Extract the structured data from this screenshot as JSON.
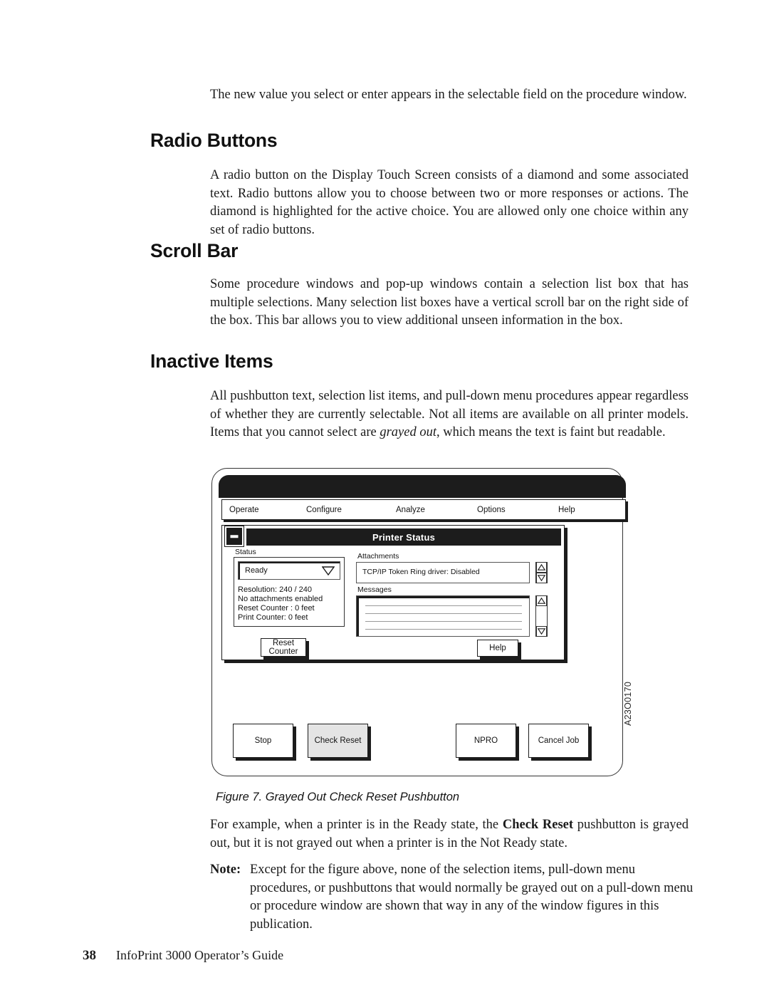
{
  "document": {
    "intro_paragraph": "The new value you select or enter appears in the selectable field on the procedure window.",
    "sections": [
      {
        "heading": "Radio Buttons",
        "body": "A radio button on the Display Touch Screen consists of a diamond and some associated text. Radio buttons allow you to choose between two or more responses or actions. The diamond is highlighted for the active choice. You are allowed only one choice within any set of radio buttons."
      },
      {
        "heading": "Scroll Bar",
        "body": "Some procedure windows and pop-up windows contain a selection list box that has multiple selections. Many selection list boxes have a vertical scroll bar on the right side of the box. This bar allows you to view additional unseen information in the box."
      },
      {
        "heading": "Inactive Items",
        "body_part1": "All pushbutton text, selection list items, and pull-down menu procedures appear regardless of whether they are currently selectable. Not all items are available on all printer models. Items that you cannot select are ",
        "body_italic": "grayed out",
        "body_part2": ", which means the text is faint but readable."
      }
    ],
    "figure_caption": "Figure 7. Grayed Out Check Reset Pushbutton",
    "after_figure_part1": "For example, when a printer is in the Ready state, the ",
    "after_figure_bold": "Check Reset",
    "after_figure_part2": " pushbutton is grayed out, but it is not grayed out when a printer is in the Not Ready state.",
    "note": {
      "label": "Note:",
      "text": "Except for the figure above, none of the selection items, pull-down menu procedures, or pushbuttons that would normally be grayed out on a pull-down menu or procedure window are shown that way in any of the window figures in this publication."
    },
    "footer": {
      "page_number": "38",
      "title": "InfoPrint 3000 Operator’s Guide"
    }
  },
  "figure": {
    "figure_id": "A23O0170",
    "menubar": [
      {
        "label": "Operate"
      },
      {
        "label": "Configure"
      },
      {
        "label": "Analyze"
      },
      {
        "label": "Options"
      },
      {
        "label": "Help"
      }
    ],
    "status_window": {
      "title": "Printer Status",
      "minimize_icon": "minimize-icon",
      "status_label": "Status",
      "status_value": "Ready",
      "status_dropdown_icon": "chevron-down-icon",
      "detail_lines": [
        "Resolution:  240 / 240",
        "No attachments enabled",
        "Reset Counter : 0 feet",
        "Print Counter: 0 feet"
      ],
      "attachments_label": "Attachments",
      "attachments_value": "TCP/IP Token Ring driver: Disabled",
      "messages_label": "Messages",
      "messages_rows": [
        "",
        "",
        "",
        ""
      ],
      "reset_counter_button": "Reset\nCounter",
      "reset_counter_line1": "Reset",
      "reset_counter_line2": "Counter",
      "help_button": "Help"
    },
    "bottom_buttons": [
      {
        "label": "Stop",
        "grayed": false
      },
      {
        "label": "Check Reset",
        "grayed": true
      },
      {
        "label": "NPRO",
        "grayed": false
      },
      {
        "label": "Cancel Job",
        "grayed": false
      }
    ]
  }
}
